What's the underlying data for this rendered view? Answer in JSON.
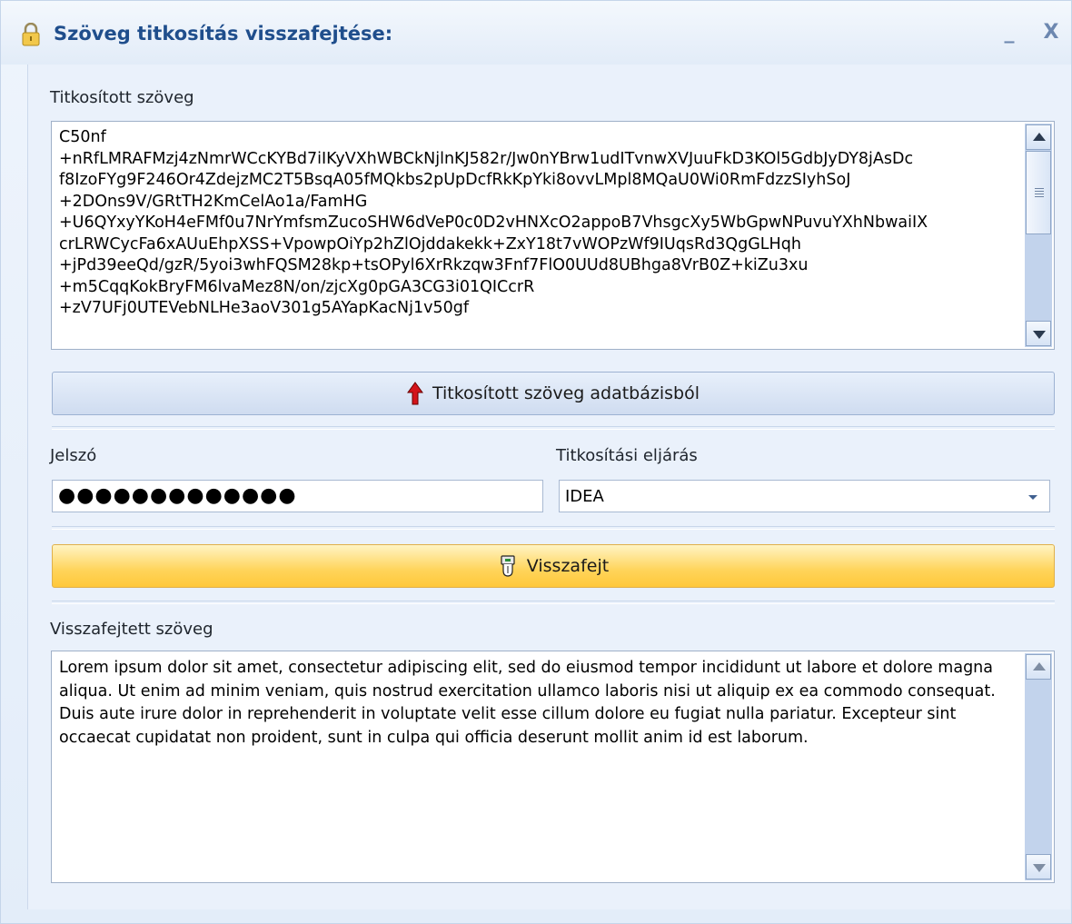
{
  "window": {
    "title": "Szöveg titkosítás visszafejtése:",
    "minimize_glyph": "_",
    "close_glyph": "X",
    "icon": "padlock-icon"
  },
  "encrypted": {
    "label": "Titkosított szöveg",
    "text": "C50nf\n+nRfLMRAFMzj4zNmrWCcKYBd7iIKyVXhWBCkNjlnKJ582r/Jw0nYBrw1udITvnwXVJuuFkD3KOl5GdbJyDY8jAsDc\nf8IzoFYg9F246Or4ZdejzMC2T5BsqA05fMQkbs2pUpDcfRkKpYki8ovvLMpl8MQaU0Wi0RmFdzzSIyhSoJ\n+2DOns9V/GRtTH2KmCelAo1a/FamHG\n+U6QYxyYKoH4eFMf0u7NrYmfsmZucoSHW6dVeP0c0D2vHNXcO2appoB7VhsgcXy5WbGpwNPuvuYXhNbwaiIX\ncrLRWCycFa6xAUuEhpXSS+VpowpOiYp2hZlOjddakekk+ZxY18t7vWOPzWf9IUqsRd3QgGLHqh\n+jPd39eeQd/gzR/5yoi3whFQSM28kp+tsOPyl6XrRkzqw3Fnf7FlO0UUd8UBhga8VrB0Z+kiZu3xu\n+m5CqqKokBryFM6lvaMez8N/on/zjcXg0pGA3CG3i01QICcrR\n+zV7UFj0UTEVebNLHe3aoV301g5AYapKacNj1v50gf"
  },
  "load_button": {
    "label": "Titkosított szöveg adatbázisból",
    "icon": "red-up-arrow-icon"
  },
  "password": {
    "label": "Jelszó",
    "value": "●●●●●●●●●●●●●"
  },
  "method": {
    "label": "Titkosítási eljárás",
    "value": "IDEA"
  },
  "decrypt_button": {
    "label": "Visszafejt",
    "icon": "key-hand-icon"
  },
  "decrypted": {
    "label": "Visszafejtett szöveg",
    "text": "Lorem ipsum dolor sit amet, consectetur adipiscing elit, sed do eiusmod tempor incididunt ut labore et dolore magna aliqua. Ut enim ad minim veniam, quis nostrud exercitation ullamco laboris nisi ut aliquip ex ea commodo consequat. Duis aute irure dolor in reprehenderit in voluptate velit esse cillum dolore eu fugiat nulla pariatur. Excepteur sint occaecat cupidatat non proident, sunt in culpa qui officia deserunt mollit anim id est laborum."
  },
  "colors": {
    "title": "#1f4e8c",
    "accent_button": "#ffd45a",
    "scrollbar": "#c2d3ec"
  }
}
